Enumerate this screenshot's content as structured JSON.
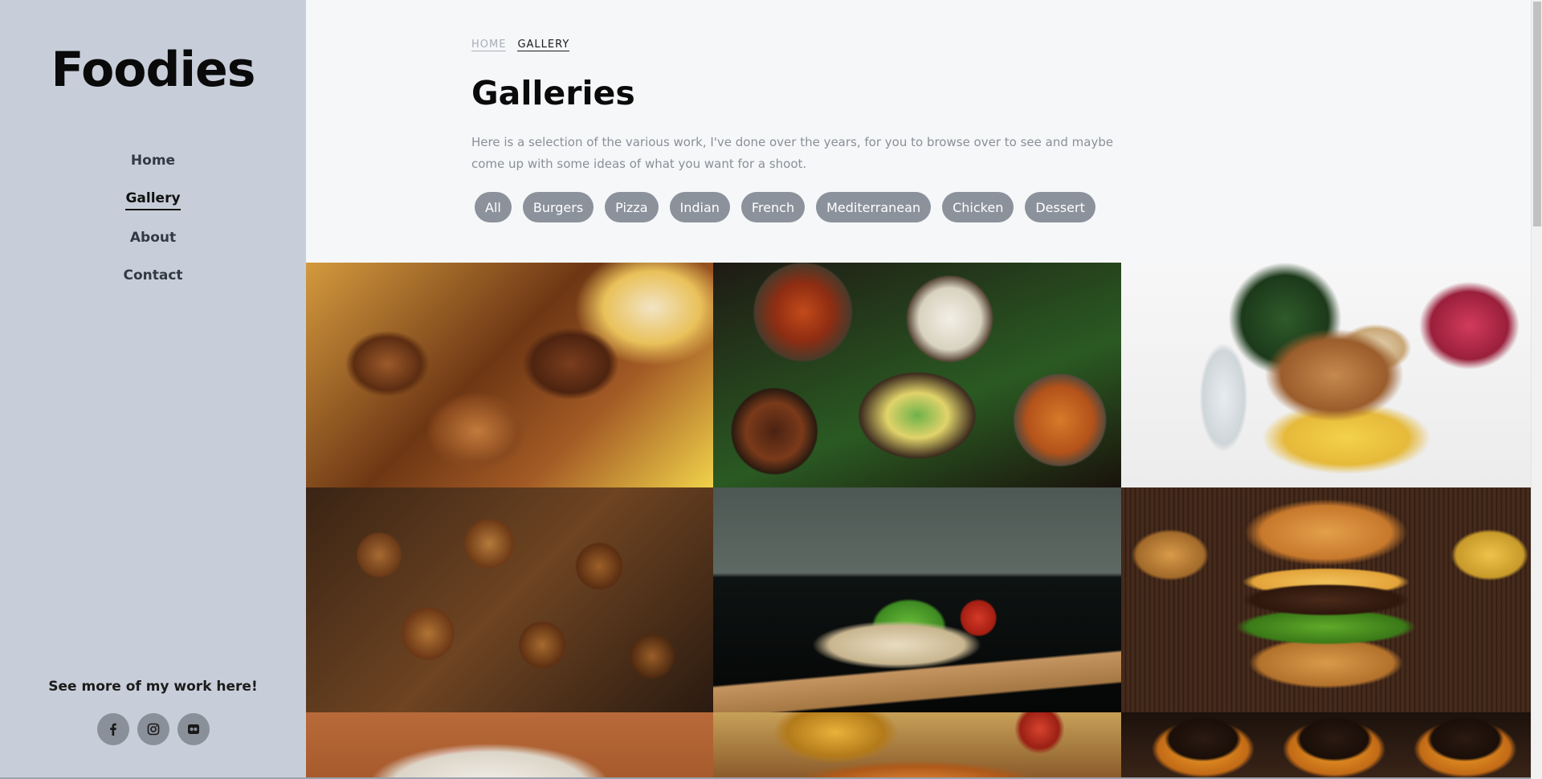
{
  "sidebar": {
    "brand": "Foodies",
    "nav": [
      {
        "label": "Home"
      },
      {
        "label": "Gallery"
      },
      {
        "label": "About"
      },
      {
        "label": "Contact"
      }
    ],
    "promo": "See more of my work here!",
    "socials": [
      {
        "icon": "facebook-icon"
      },
      {
        "icon": "instagram-icon"
      },
      {
        "icon": "flickr-icon"
      }
    ]
  },
  "breadcrumb": {
    "home": "HOME",
    "current": "GALLERY"
  },
  "page": {
    "title": "Galleries",
    "intro": "Here is a selection of the various work, I've done over the years, for you to browse over to see and maybe come up with some ideas of what you want for a shoot."
  },
  "filters": [
    "All",
    "Burgers",
    "Pizza",
    "Indian",
    "French",
    "Mediterranean",
    "Chicken",
    "Dessert"
  ],
  "gallery": [
    {
      "subject": "fried chicken pieces"
    },
    {
      "subject": "indian dishes spread"
    },
    {
      "subject": "french fish plate"
    },
    {
      "subject": "chicken nuggets"
    },
    {
      "subject": "wrap on board"
    },
    {
      "subject": "cheeseburger"
    },
    {
      "subject": "fries with ketchup"
    },
    {
      "subject": "pizza"
    },
    {
      "subject": "burger patties"
    }
  ],
  "colors": {
    "sidebar_bg": "#c8ced9",
    "main_bg": "#f6f7f9",
    "chip_bg": "#8c929c",
    "social_bg": "#8a909a"
  }
}
